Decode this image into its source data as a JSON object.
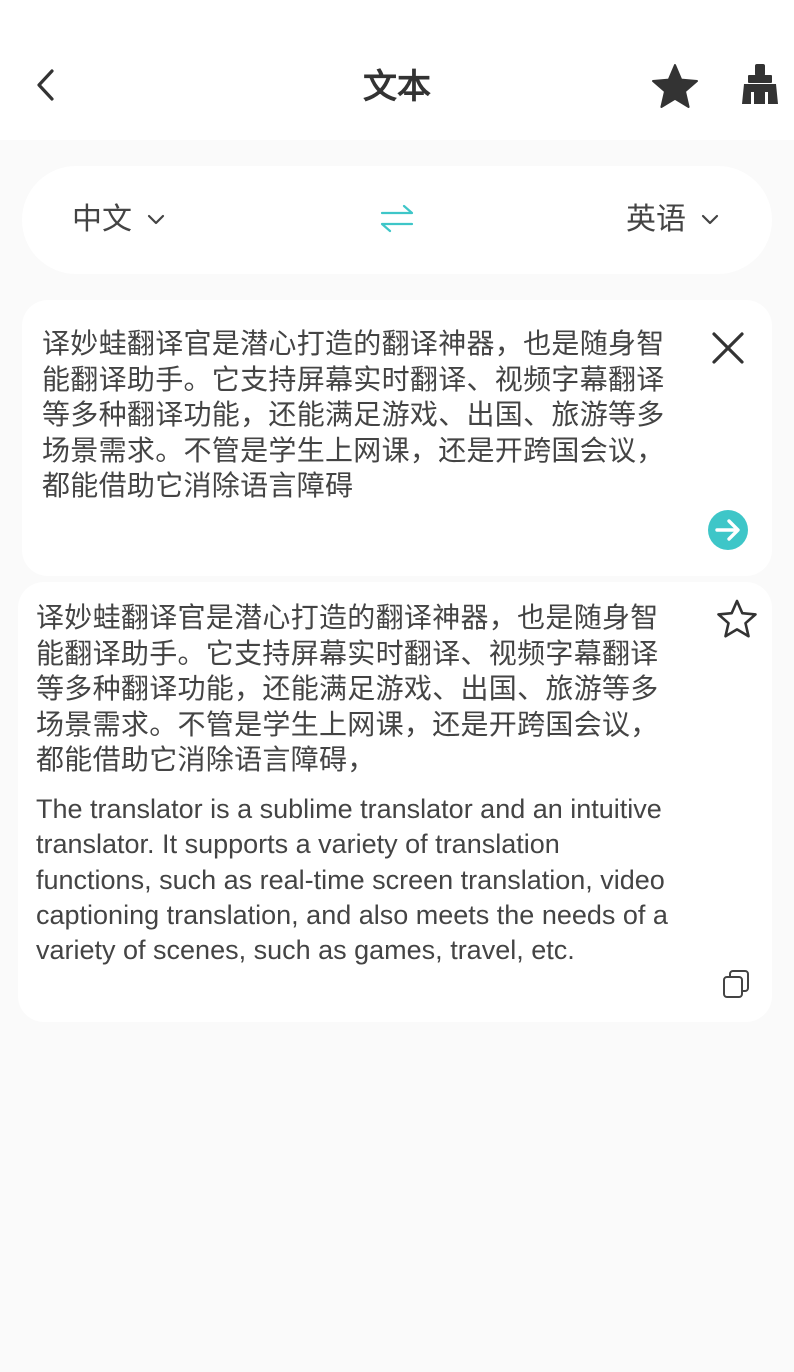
{
  "header": {
    "title": "文本",
    "back_icon": "chevron-left-icon",
    "star_icon": "star-filled-icon",
    "clear_icon": "broom-icon"
  },
  "languages": {
    "source": "中文",
    "target": "英语",
    "swap_icon": "swap-arrows-icon",
    "accent_color": "#3ec6c8"
  },
  "input": {
    "text": "译妙蛙翻译官是潜心打造的翻译神器，也是随身智能翻译助手。它支持屏幕实时翻译、视频字幕翻译等多种翻译功能，还能满足游戏、出国、旅游等多场景需求。不管是学生上网课，还是开跨国会议，都能借助它消除语言障碍",
    "close_icon": "close-icon",
    "submit_icon": "arrow-right-circle-icon"
  },
  "result": {
    "source_text": "译妙蛙翻译官是潜心打造的翻译神器，也是随身智能翻译助手。它支持屏幕实时翻译、视频字幕翻译等多种翻译功能，还能满足游戏、出国、旅游等多场景需求。不管是学生上网课，还是开跨国会议，都能借助它消除语言障碍，",
    "translated_text": "The translator is a sublime translator and an intuitive translator. It supports a variety of translation functions, such as real-time screen translation, video captioning translation, and also meets the needs of a variety of scenes, such as games, travel, etc.",
    "favorite_icon": "star-outline-icon",
    "copy_icon": "copy-icon"
  }
}
